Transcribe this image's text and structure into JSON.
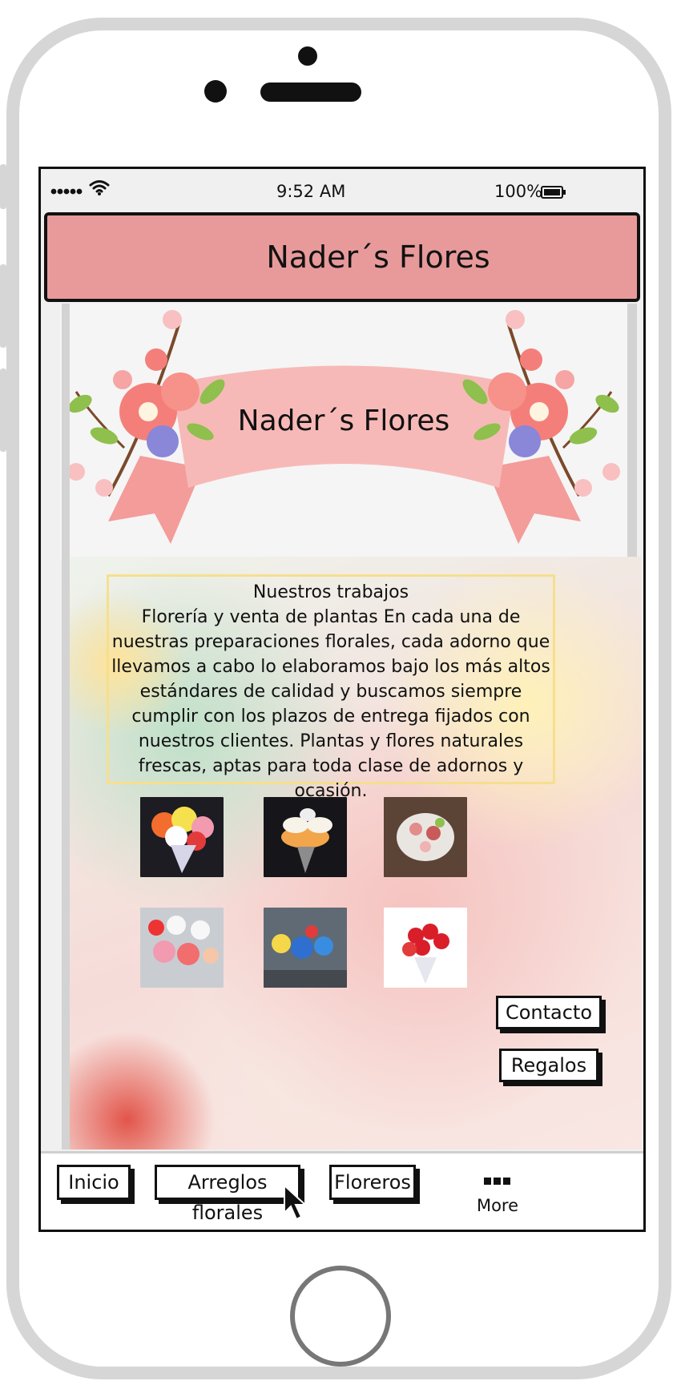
{
  "status_bar": {
    "time": "9:52 AM",
    "battery": "100%",
    "signal_icon": "signal-dots-icon",
    "wifi_icon": "wifi-icon",
    "battery_icon": "battery-icon"
  },
  "header": {
    "title": "Nader´s Flores"
  },
  "banner": {
    "title": "Nader´s Flores"
  },
  "intro": {
    "heading": "Nuestros trabajos",
    "body": "Florería y venta de plantas En cada una de nuestras preparaciones florales, cada adorno que llevamos a cabo lo elaboramos bajo los más altos estándares de calidad y buscamos siempre cumplir con los plazos de entrega fijados con nuestros clientes. Plantas y flores naturales frescas, aptas para toda clase de adornos y ocasión."
  },
  "gallery": {
    "images": [
      "bouquet-image-1",
      "bouquet-image-2",
      "bouquet-image-3",
      "bouquet-image-4",
      "bouquet-image-5",
      "bouquet-image-6"
    ]
  },
  "side_buttons": {
    "contact": "Contacto",
    "gifts": "Regalos"
  },
  "tab_bar": {
    "home": "Inicio",
    "arrangements": "Arreglos florales",
    "vases": "Floreros",
    "more": "More",
    "more_icon": "more-dots-icon"
  },
  "colors": {
    "header_bg": "#e89a9a",
    "ribbon": "#f7b9b7",
    "text_border": "#f6df8e"
  }
}
